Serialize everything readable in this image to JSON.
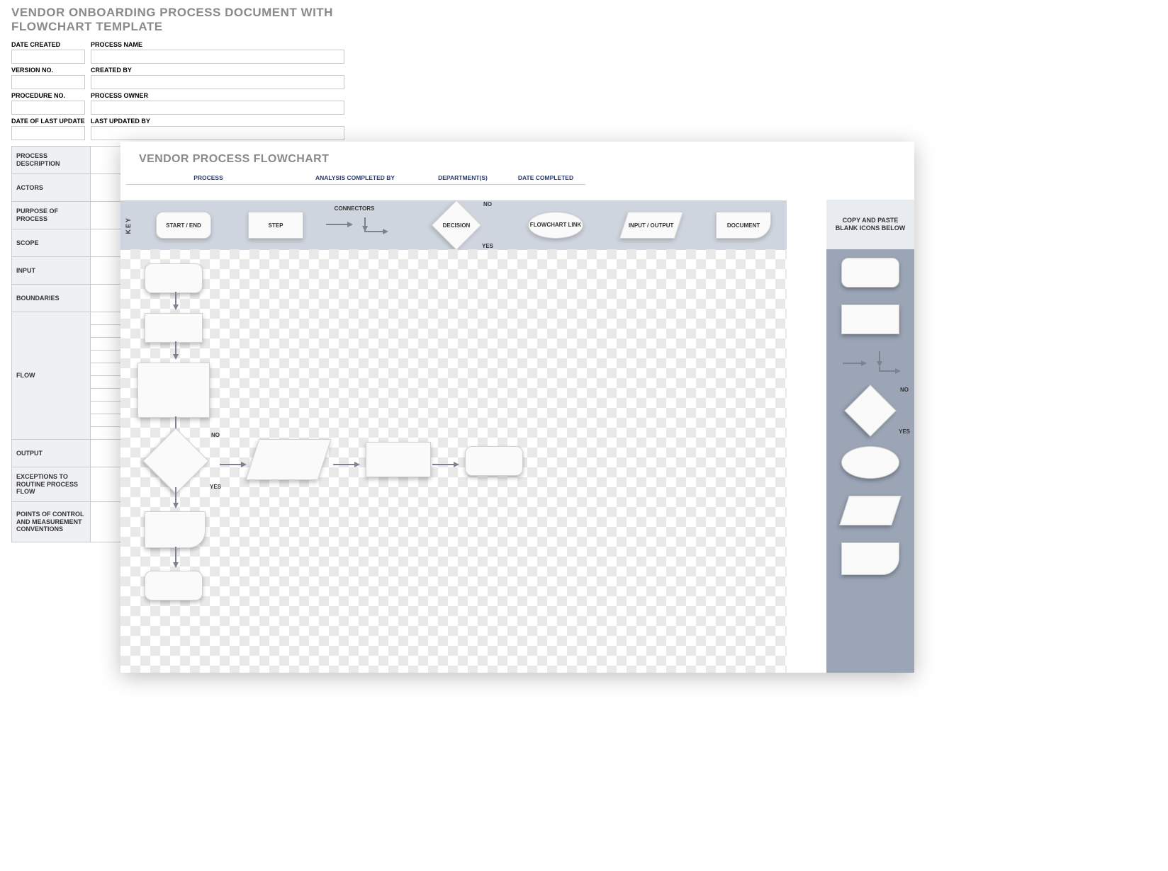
{
  "doc": {
    "title": "VENDOR ONBOARDING  PROCESS DOCUMENT  WITH FLOWCHART TEMPLATE",
    "header_rows": [
      {
        "left": "DATE CREATED",
        "right": "PROCESS NAME"
      },
      {
        "left": "VERSION NO.",
        "right": "CREATED BY"
      },
      {
        "left": "PROCEDURE NO.",
        "right": "PROCESS OWNER"
      },
      {
        "left": "DATE OF LAST UPDATE",
        "right": "LAST UPDATED BY"
      }
    ],
    "grid_labels": {
      "process_description": "PROCESS DESCRIPTION",
      "actors": "ACTORS",
      "purpose": "PURPOSE OF PROCESS",
      "scope": "SCOPE",
      "input": "INPUT",
      "boundaries": "BOUNDARIES",
      "flow": "FLOW",
      "output": "OUTPUT",
      "exceptions": "EXCEPTIONS TO ROUTINE PROCESS FLOW",
      "points": "POINTS OF CONTROL AND MEASUREMENT CONVENTIONS"
    }
  },
  "panel": {
    "title": "VENDOR PROCESS FLOWCHART",
    "meta": {
      "process": "PROCESS",
      "analysis_by": "ANALYSIS COMPLETED BY",
      "departments": "DEPARTMENT(S)",
      "date_completed": "DATE COMPLETED"
    },
    "key": {
      "label": "KEY",
      "start_end": "START / END",
      "step": "STEP",
      "connectors": "CONNECTORS",
      "decision": "DECISION",
      "decision_no": "NO",
      "decision_yes": "YES",
      "link": "FLOWCHART LINK",
      "io": "INPUT / OUTPUT",
      "document": "DOCUMENT"
    },
    "side": {
      "header": "COPY AND PASTE BLANK ICONS BELOW",
      "decision_no": "NO",
      "decision_yes": "YES"
    },
    "canvas": {
      "decision_no": "NO",
      "decision_yes": "YES"
    }
  }
}
